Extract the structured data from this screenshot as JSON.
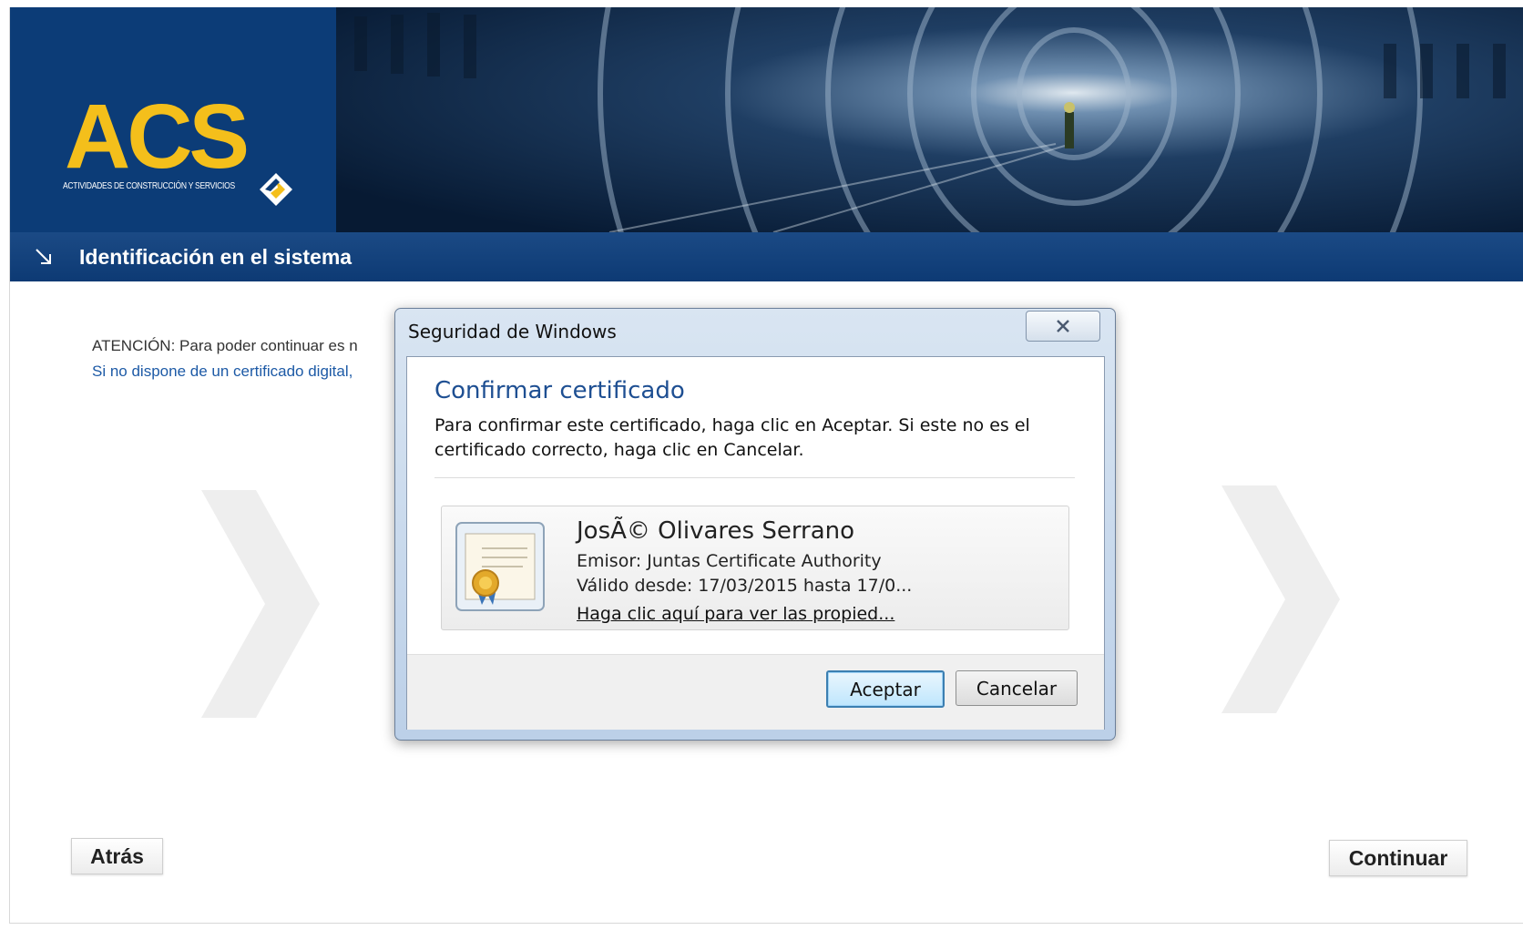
{
  "header": {
    "logo_text": "ACS",
    "logo_subtitle": "ACTIVIDADES DE CONSTRUCCIÓN Y SERVICIOS",
    "page_title": "Identificación en el sistema"
  },
  "content": {
    "notice_line1": "ATENCIÓN: Para poder continuar es n",
    "notice_line2": "Si no dispone de un certificado digital,"
  },
  "footer": {
    "back_label": "Atrás",
    "continue_label": "Continuar"
  },
  "dialog": {
    "window_title": "Seguridad de Windows",
    "heading": "Confirmar certificado",
    "description": "Para confirmar este certificado, haga clic en Aceptar. Si este no es el certificado correcto, haga clic en Cancelar.",
    "certificate": {
      "name": "JosÃ© Olivares Serrano",
      "issuer": "Emisor: Juntas Certificate Authority",
      "validity": "Válido desde: 17/03/2015 hasta 17/0...",
      "properties_link": "Haga clic aquí para ver las propied..."
    },
    "accept_label": "Aceptar",
    "cancel_label": "Cancelar"
  },
  "colors": {
    "brand_blue": "#0c3c77",
    "brand_yellow": "#f4bf1b",
    "link_blue": "#1d5aa6",
    "dialog_heading_blue": "#1e4f92"
  }
}
